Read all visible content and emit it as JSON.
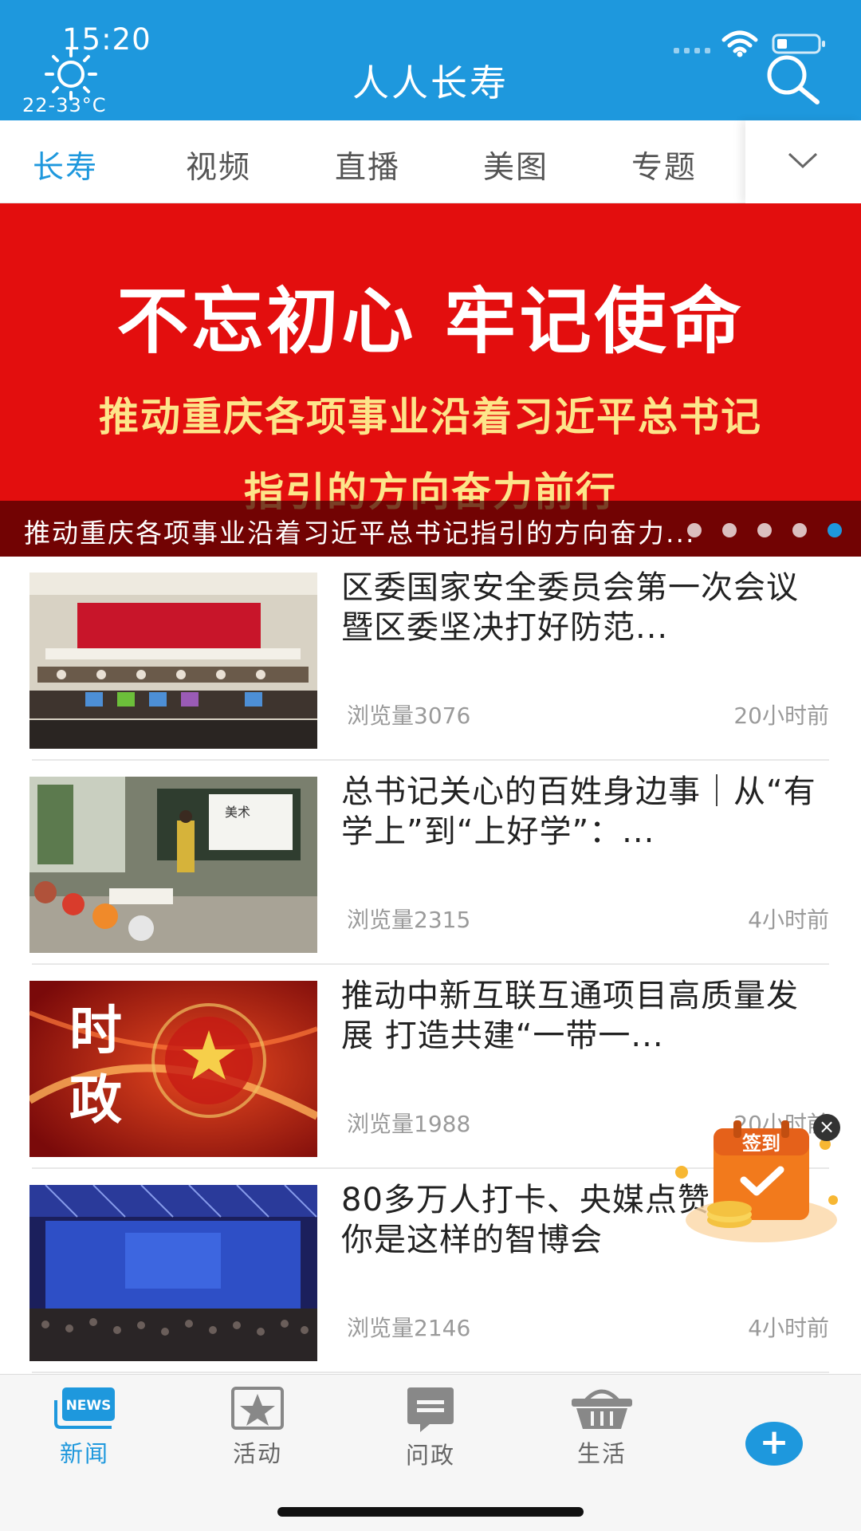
{
  "status_bar": {
    "time": "15:20",
    "temperature": "22-33°C"
  },
  "header": {
    "title": "人人长寿"
  },
  "tabs": [
    {
      "label": "长寿",
      "active": true
    },
    {
      "label": "视频",
      "active": false
    },
    {
      "label": "直播",
      "active": false
    },
    {
      "label": "美图",
      "active": false
    },
    {
      "label": "专题",
      "active": false
    }
  ],
  "banner": {
    "headline": "不忘初心  牢记使命",
    "line2": "推动重庆各项事业沿着习近平总书记",
    "line3": "指引的方向奋力前行",
    "caption": "推动重庆各项事业沿着习近平总书记指引的方向奋力...",
    "active_slide": 5,
    "slide_count": 5
  },
  "news": [
    {
      "title": "区委国家安全委员会第一次会议暨区委坚决打好防范...",
      "views": "浏览量3076",
      "time": "20小时前",
      "thumb_text": ""
    },
    {
      "title": "总书记关心的百姓身边事｜从“有学上”到“上好学”：...",
      "views": "浏览量2315",
      "time": "4小时前",
      "thumb_text": "美术"
    },
    {
      "title": "推动中新互联互通项目高质量发展 打造共建“一带一...",
      "views": "浏览量1988",
      "time": "20小时前",
      "thumb_text": "时政"
    },
    {
      "title": "80多万人打卡、央媒点赞，原来你是这样的智博会",
      "views": "浏览量2146",
      "time": "4小时前",
      "thumb_text": ""
    }
  ],
  "signin": {
    "label": "签到",
    "close": "×"
  },
  "bottom_nav": [
    {
      "label": "新闻",
      "icon": "news-icon",
      "active": true,
      "badge": "NEWS"
    },
    {
      "label": "活动",
      "icon": "star-icon",
      "active": false
    },
    {
      "label": "问政",
      "icon": "bookmark-icon",
      "active": false
    },
    {
      "label": "生活",
      "icon": "basket-icon",
      "active": false
    }
  ],
  "plus_button": "+",
  "colors": {
    "primary": "#1e98dd",
    "banner_red": "#e30e0e",
    "banner_yellow": "#fde58a"
  }
}
